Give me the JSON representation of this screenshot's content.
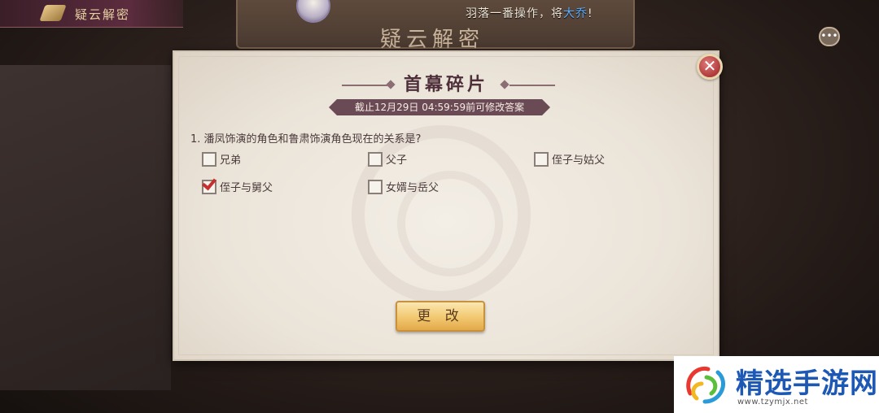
{
  "background": {
    "top_left_title": "疑云解密",
    "board_title": "疑云解密",
    "ticker_text": "羽落一番操作，将",
    "ticker_highlight": "大乔",
    "ticker_suffix": "!"
  },
  "dialog": {
    "title": "首幕碎片",
    "deadline": "截止12月29日 04:59:59前可修改答案",
    "question": "1. 潘凤饰演的角色和鲁肃饰演角色现在的关系是?",
    "options": [
      {
        "label": "兄弟",
        "checked": false
      },
      {
        "label": "父子",
        "checked": false
      },
      {
        "label": "侄子与姑父",
        "checked": false
      },
      {
        "label": "侄子与舅父",
        "checked": true
      },
      {
        "label": "女婿与岳父",
        "checked": false
      }
    ],
    "close_icon": "close-icon",
    "change_button": "更 改"
  },
  "chat_icon": "chat-icon",
  "logo": {
    "text": "精选手游网",
    "url": "www.tzymjx.net"
  },
  "colors": {
    "accent_title": "#4e2f3a",
    "deadline_bg": "#6a4a55",
    "button_gold": "#f2c870",
    "check_red": "#c62f2f",
    "logo_blue": "#1d58b5"
  }
}
